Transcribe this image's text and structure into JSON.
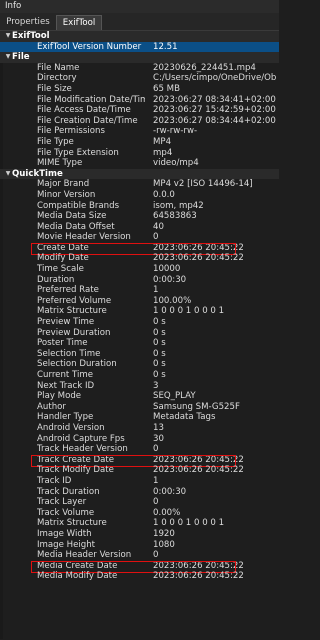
{
  "panel": {
    "title": "Info"
  },
  "tabs": [
    {
      "label": "Properties"
    },
    {
      "label": "ExifTool"
    }
  ],
  "rows": [
    {
      "type": "section",
      "label": "ExifTool"
    },
    {
      "name": "ExifTool Version Number",
      "value": "12.51",
      "selected": true
    },
    {
      "type": "section",
      "label": "File"
    },
    {
      "name": "File Name",
      "value": "20230626_224451.mp4"
    },
    {
      "name": "Directory",
      "value": "C:/Users/cimpo/OneDrive/Obrázky"
    },
    {
      "name": "File Size",
      "value": "65 MB"
    },
    {
      "name": "File Modification Date/Time",
      "value": "2023:06:27 08:34:41+02:00"
    },
    {
      "name": "File Access Date/Time",
      "value": "2023:06:27 15:42:59+02:00"
    },
    {
      "name": "File Creation Date/Time",
      "value": "2023:06:27 08:34:44+02:00"
    },
    {
      "name": "File Permissions",
      "value": "-rw-rw-rw-"
    },
    {
      "name": "File Type",
      "value": "MP4"
    },
    {
      "name": "File Type Extension",
      "value": "mp4"
    },
    {
      "name": "MIME Type",
      "value": "video/mp4"
    },
    {
      "type": "section",
      "label": "QuickTime"
    },
    {
      "name": "Major Brand",
      "value": "MP4 v2 [ISO 14496-14]"
    },
    {
      "name": "Minor Version",
      "value": "0.0.0"
    },
    {
      "name": "Compatible Brands",
      "value": "isom, mp42"
    },
    {
      "name": "Media Data Size",
      "value": "64583863"
    },
    {
      "name": "Media Data Offset",
      "value": "40"
    },
    {
      "name": "Movie Header Version",
      "value": "0"
    },
    {
      "name": "Create Date",
      "value": "2023:06:26 20:45:22",
      "highlight": true
    },
    {
      "name": "Modify Date",
      "value": "2023:06:26 20:45:22"
    },
    {
      "name": "Time Scale",
      "value": "10000"
    },
    {
      "name": "Duration",
      "value": "0:00:30"
    },
    {
      "name": "Preferred Rate",
      "value": "1"
    },
    {
      "name": "Preferred Volume",
      "value": "100.00%"
    },
    {
      "name": "Matrix Structure",
      "value": "1 0 0 0 1 0 0 0 1"
    },
    {
      "name": "Preview Time",
      "value": "0 s"
    },
    {
      "name": "Preview Duration",
      "value": "0 s"
    },
    {
      "name": "Poster Time",
      "value": "0 s"
    },
    {
      "name": "Selection Time",
      "value": "0 s"
    },
    {
      "name": "Selection Duration",
      "value": "0 s"
    },
    {
      "name": "Current Time",
      "value": "0 s"
    },
    {
      "name": "Next Track ID",
      "value": "3"
    },
    {
      "name": "Play Mode",
      "value": "SEQ_PLAY"
    },
    {
      "name": "Author",
      "value": "Samsung SM-G525F"
    },
    {
      "name": "Handler Type",
      "value": "Metadata Tags"
    },
    {
      "name": "Android Version",
      "value": "13"
    },
    {
      "name": "Android Capture Fps",
      "value": "30"
    },
    {
      "name": "Track Header Version",
      "value": "0"
    },
    {
      "name": "Track Create Date",
      "value": "2023:06:26 20:45:22",
      "highlight": true
    },
    {
      "name": "Track Modify Date",
      "value": "2023:06:26 20:45:22"
    },
    {
      "name": "Track ID",
      "value": "1"
    },
    {
      "name": "Track Duration",
      "value": "0:00:30"
    },
    {
      "name": "Track Layer",
      "value": "0"
    },
    {
      "name": "Track Volume",
      "value": "0.00%"
    },
    {
      "name": "Matrix Structure",
      "value": "1 0 0 0 1 0 0 0 1"
    },
    {
      "name": "Image Width",
      "value": "1920"
    },
    {
      "name": "Image Height",
      "value": "1080"
    },
    {
      "name": "Media Header Version",
      "value": "0"
    },
    {
      "name": "Media Create Date",
      "value": "2023:06:26 20:45:22",
      "highlight": true
    },
    {
      "name": "Media Modify Date",
      "value": "2023:06:26 20:45:22"
    }
  ],
  "colors": {
    "highlight_box": "#e01010",
    "selection": "#0b4f87",
    "background": "#1e1e1e"
  }
}
